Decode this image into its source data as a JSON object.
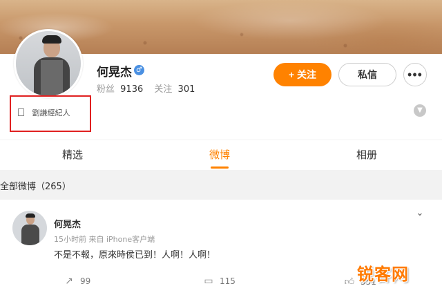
{
  "profile": {
    "name": "何晃杰",
    "gender_icon": "male-icon",
    "fans_label": "粉丝",
    "fans_count": "9136",
    "following_label": "关注",
    "following_count": "301",
    "bio": "劉謙經紀人"
  },
  "actions": {
    "follow_label": "+ 关注",
    "message_label": "私信",
    "more_label": "•••"
  },
  "tabs": [
    {
      "label": "精选",
      "active": false
    },
    {
      "label": "微博",
      "active": true
    },
    {
      "label": "相册",
      "active": false
    }
  ],
  "feed": {
    "title": "全部微博（265）"
  },
  "post": {
    "author": "何晃杰",
    "meta": "15小时前 来自 iPhone客户端",
    "text": "不是不報，原來時侯已到！人啊！人啊！",
    "repost_count": "99",
    "comment_count": "115",
    "like_count": "551"
  },
  "watermark": "锐客网",
  "colors": {
    "accent": "#ff8200",
    "highlight_box": "#e02020"
  }
}
